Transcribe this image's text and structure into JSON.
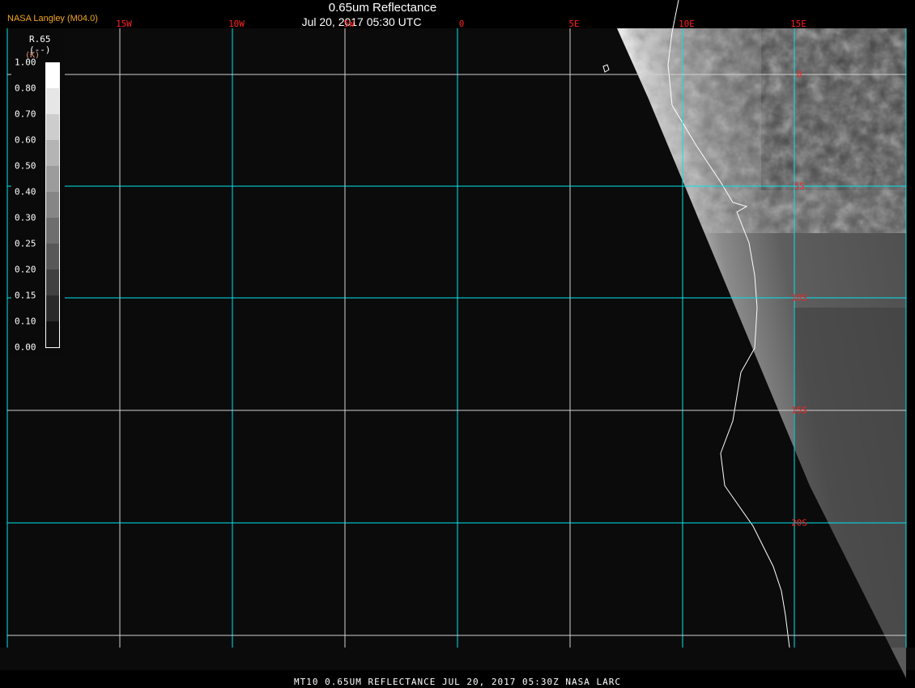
{
  "header": {
    "title": "0.65um Reflectance",
    "subtitle": "Jul 20, 2017 05:30 UTC",
    "producer": "NASA Langley (M04.0)"
  },
  "longitude_labels": [
    "15W",
    "10W",
    "5W",
    "0",
    "5E",
    "10E",
    "15E"
  ],
  "latitude_labels": [
    "0",
    "5S",
    "10S",
    "15S",
    "20S"
  ],
  "legend": {
    "title": "R.65",
    "unit": "(--)",
    "unit_k": "(K)",
    "ticks": [
      "1.00",
      "0.80",
      "0.70",
      "0.60",
      "0.50",
      "0.40",
      "0.30",
      "0.25",
      "0.20",
      "0.15",
      "0.10",
      "0.00"
    ],
    "colors": [
      "#ffffff",
      "#e6e6e6",
      "#cdcdcd",
      "#b4b4b4",
      "#9c9c9c",
      "#868686",
      "#6e6e6e",
      "#585858",
      "#414141",
      "#2a2a2a",
      "#101010"
    ]
  },
  "footer": "MT10  0.65UM REFLECTANCE   JUL 20, 2017 05:30Z   NASA LARC",
  "colors": {
    "grid_cyan": "#00e5ee",
    "grid_white": "#d0d0d0",
    "label_red": "#ff2020",
    "space": "#0b0b0b"
  }
}
